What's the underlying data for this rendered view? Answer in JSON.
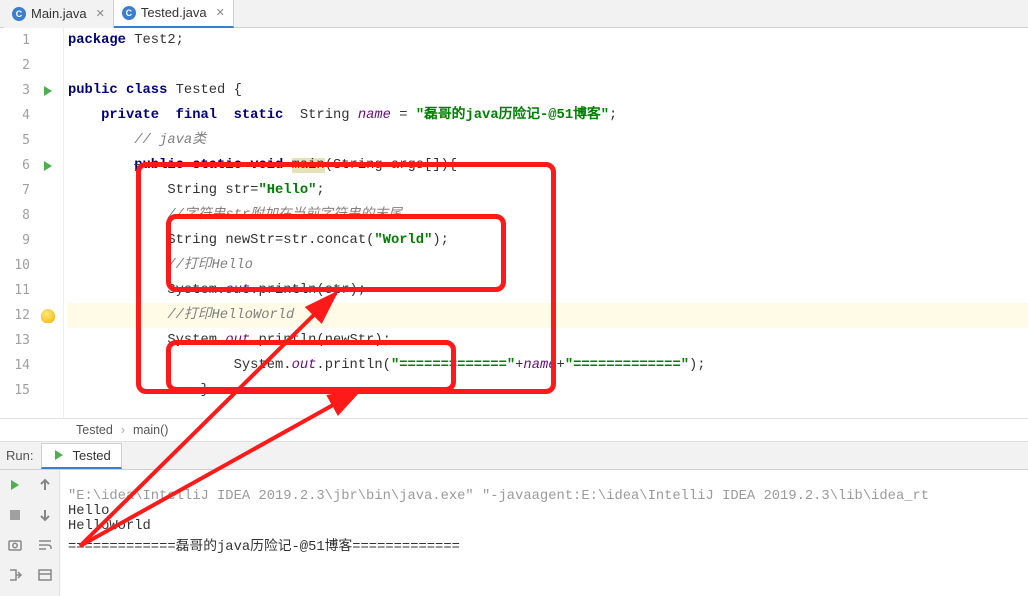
{
  "tabs": [
    {
      "label": "Main.java",
      "active": false
    },
    {
      "label": "Tested.java",
      "active": true
    }
  ],
  "editor": {
    "lines": {
      "l1": {
        "num": "1",
        "kw1": "package",
        "pkg": "Test2"
      },
      "l2": {
        "num": "2"
      },
      "l3": {
        "num": "3",
        "kw1": "public",
        "kw2": "class",
        "cls": "Tested"
      },
      "l4": {
        "num": "4",
        "kw1": "private",
        "kw2": "final",
        "kw3": "static",
        "type": "String",
        "field": "name",
        "eq": " = ",
        "val": "\"磊哥的java历险记-@51博客\""
      },
      "l5": {
        "num": "5",
        "cmt": "// java类"
      },
      "l6": {
        "num": "6",
        "kw1": "public",
        "kw2": "static",
        "kw3": "void",
        "m": "main",
        "sig": "(String args[]){"
      },
      "l7": {
        "num": "7",
        "type": "String",
        "var": "str",
        "val": "\"Hello\""
      },
      "l8": {
        "num": "8",
        "cmt": "//字符串str附加在当前字符串的末尾"
      },
      "l9": {
        "num": "9",
        "type": "String",
        "var": "newStr",
        "rhs1": "str",
        "m": "concat",
        "arg": "\"World\""
      },
      "l10": {
        "num": "10",
        "cmt": "//打印Hello"
      },
      "l11": {
        "num": "11",
        "obj": "System",
        "fld": "out",
        "m": "println",
        "arg": "str"
      },
      "l12": {
        "num": "12",
        "cmt": "//打印HelloWorld"
      },
      "l13": {
        "num": "13",
        "obj": "System",
        "fld": "out",
        "m": "println",
        "arg": "newStr"
      },
      "l14": {
        "num": "14",
        "obj": "System",
        "fld": "out",
        "m": "println",
        "s1": "\"=============\"",
        "plus1": "+",
        "field": "name",
        "plus2": "+",
        "s2": "\"=============\""
      },
      "l15": {
        "num": "15"
      }
    },
    "current_line": 12
  },
  "breadcrumb": {
    "a": "Tested",
    "b": "main()"
  },
  "run": {
    "label": "Run:",
    "tab": "Tested",
    "console": {
      "cmd": "\"E:\\idea\\IntelliJ IDEA 2019.2.3\\jbr\\bin\\java.exe\" \"-javaagent:E:\\idea\\IntelliJ IDEA 2019.2.3\\lib\\idea_rt",
      "o1": "Hello",
      "o2": "HelloWorld",
      "o3": "=============磊哥的java历险记-@51博客============="
    }
  }
}
